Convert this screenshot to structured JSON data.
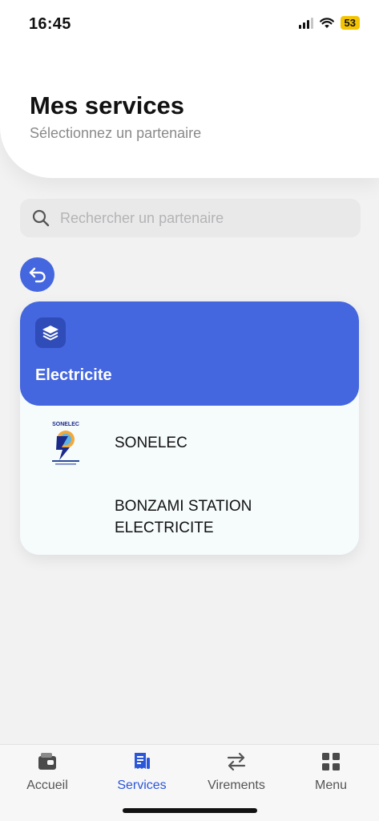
{
  "status_bar": {
    "time": "16:45",
    "battery": "53"
  },
  "header": {
    "title": "Mes services",
    "subtitle": "Sélectionnez un partenaire"
  },
  "search": {
    "placeholder": "Rechercher un partenaire",
    "value": "",
    "icon": "search-icon"
  },
  "back_button": {
    "icon": "back-arrow-icon"
  },
  "category": {
    "icon": "layers-icon",
    "title": "Electricite",
    "partners": [
      {
        "name": "SONELEC",
        "logo_text": "SONELEC"
      },
      {
        "name": "BONZAMI STATION ELECTRICITE"
      }
    ]
  },
  "tabbar": {
    "items": [
      {
        "label": "Accueil",
        "icon": "wallet-icon"
      },
      {
        "label": "Services",
        "icon": "receipt-icon",
        "active": true
      },
      {
        "label": "Virements",
        "icon": "transfer-icon"
      },
      {
        "label": "Menu",
        "icon": "grid-icon"
      }
    ]
  },
  "colors": {
    "accent": "#4466de",
    "active_tab": "#2b56d8",
    "background": "#f2f2f3"
  }
}
